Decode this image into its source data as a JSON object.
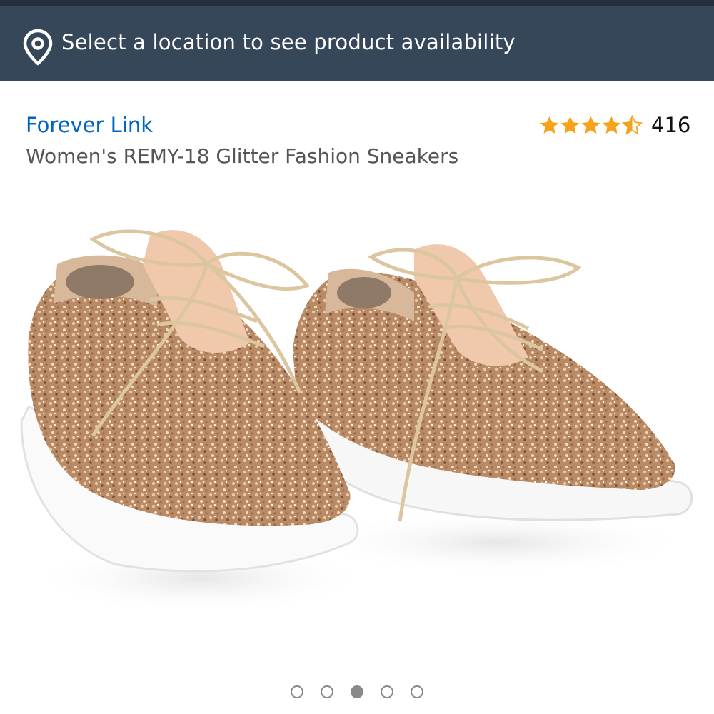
{
  "location_bar": {
    "text": "Select a location to see product availability",
    "icon": "location-pin-icon"
  },
  "product": {
    "brand": "Forever Link",
    "title": "Women's REMY-18 Glitter Fashion Sneakers",
    "rating": {
      "stars": 4.5,
      "max_stars": 5,
      "review_count": "416"
    },
    "image_description_icon": "product-image"
  },
  "carousel": {
    "total": 5,
    "active_index": 2
  },
  "colors": {
    "header_bg": "#37475a",
    "top_strip": "#232f3e",
    "link": "#0066c0",
    "star": "#f7a21b",
    "glitter": "#c9a07a"
  }
}
